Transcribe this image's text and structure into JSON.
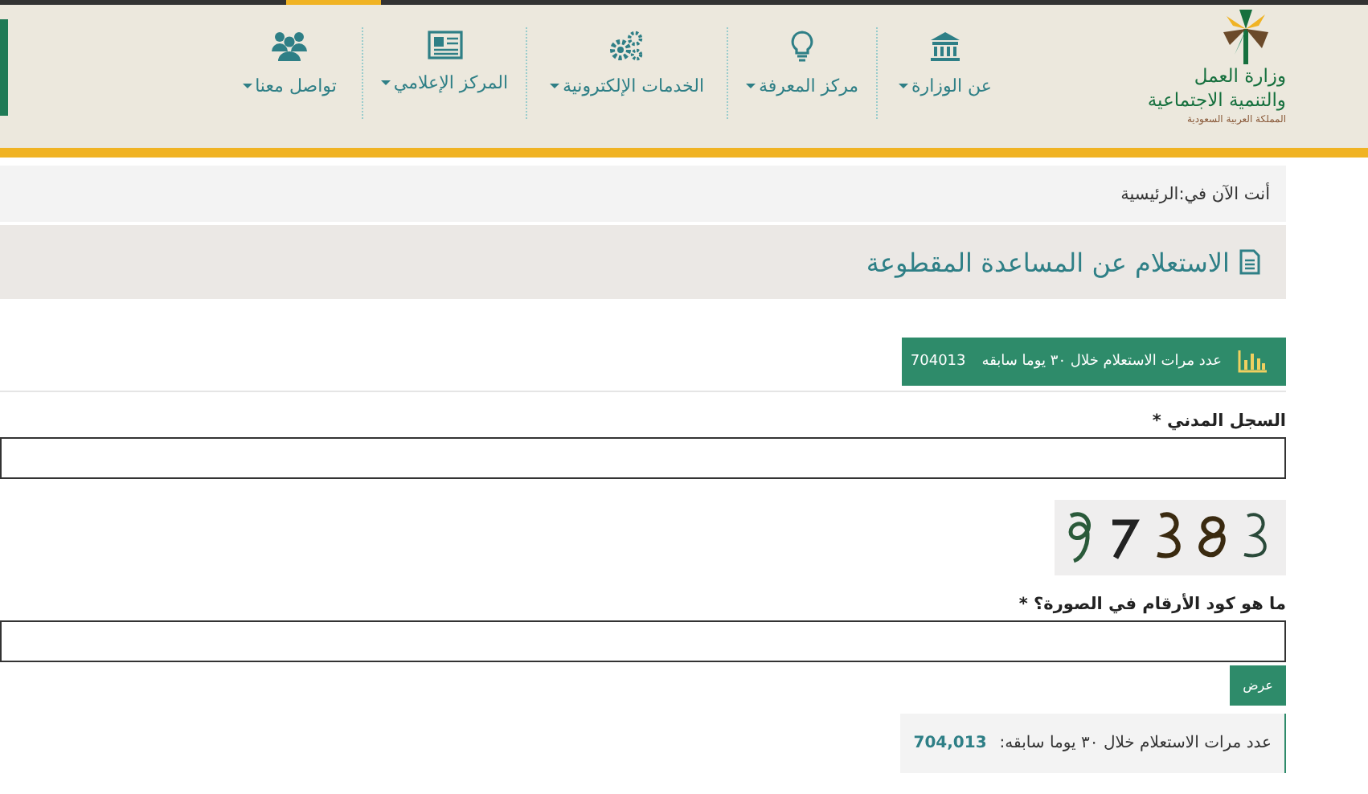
{
  "header": {
    "logo": {
      "lines": [
        "وزارة العمل",
        "والتنمية الاجتماعية",
        "المملكة العربية السعودية"
      ]
    },
    "nav": [
      {
        "label": "عن الوزارة",
        "kind": "building"
      },
      {
        "label": "مركز المعرفة",
        "kind": "bulb"
      },
      {
        "label": "الخدمات الإلكترونية",
        "kind": "gears"
      },
      {
        "label": "المركز الإعلامي",
        "kind": "news"
      },
      {
        "label": "تواصل معنا",
        "kind": "people"
      }
    ]
  },
  "breadcrumb": {
    "prefix": "أنت الآن في:",
    "current": "الرئيسية"
  },
  "page_title": "الاستعلام عن المساعدة المقطوعة",
  "stats_bar": {
    "label": "عدد مرات الاستعلام خلال ٣٠ يوما سابقه",
    "value": "704013"
  },
  "form": [
    {
      "kind": "field",
      "label": "السجل المدني *"
    },
    {
      "kind": "captcha"
    },
    {
      "kind": "field",
      "label": "ما هو كود الأرقام في الصورة؟ *"
    }
  ],
  "submit_button": "عرض",
  "summary": {
    "label": "عدد مرات الاستعلام خلال ٣٠ يوما سابقه:",
    "value": "704,013"
  }
}
